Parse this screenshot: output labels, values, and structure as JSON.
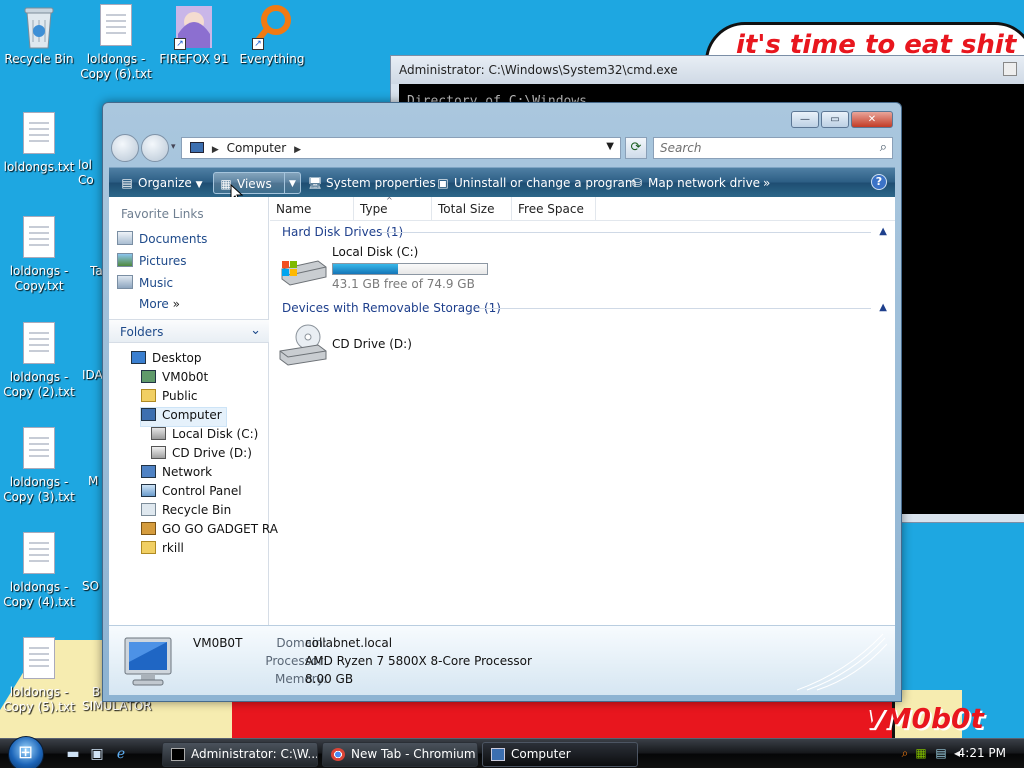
{
  "desktop": {
    "wallpaper_text": "it's time to eat shit",
    "wallpaper_signature": "VM0b0t",
    "icons": [
      {
        "label": "Recycle Bin"
      },
      {
        "label": "loldongs - Copy (6).txt"
      },
      {
        "label": "FIREFOX 91"
      },
      {
        "label": "Everything"
      },
      {
        "label": "loldongs.txt"
      },
      {
        "label": "loldongs - Copy.txt"
      },
      {
        "label": "loldongs - Copy (2).txt"
      },
      {
        "label": "loldongs - Copy (3).txt"
      },
      {
        "label": "loldongs - Copy (4).txt"
      },
      {
        "label": "loldongs - Copy (5).txt"
      }
    ],
    "partial_labels": [
      "lol",
      "Co",
      "Ta",
      "IDA",
      "M",
      "SO",
      "B",
      "SIMULATOR"
    ]
  },
  "cmd": {
    "title": "Administrator: C:\\Windows\\System32\\cmd.exe",
    "body_line": "Directory of C:\\Windows"
  },
  "explorer": {
    "address": "Computer",
    "search_placeholder": "Search",
    "toolbar": {
      "organize": "Organize",
      "views": "Views",
      "system_properties": "System properties",
      "uninstall": "Uninstall or change a program",
      "map_drive": "Map network drive",
      "more": "»"
    },
    "favorites_title": "Favorite Links",
    "favorites": [
      {
        "label": "Documents"
      },
      {
        "label": "Pictures"
      },
      {
        "label": "Music"
      },
      {
        "label": "More"
      }
    ],
    "folders_title": "Folders",
    "tree": [
      {
        "label": "Desktop"
      },
      {
        "label": "VM0b0t"
      },
      {
        "label": "Public"
      },
      {
        "label": "Computer"
      },
      {
        "label": "Local Disk (C:)"
      },
      {
        "label": "CD Drive (D:)"
      },
      {
        "label": "Network"
      },
      {
        "label": "Control Panel"
      },
      {
        "label": "Recycle Bin"
      },
      {
        "label": "GO GO GADGET RA"
      },
      {
        "label": "rkill"
      }
    ],
    "columns": [
      "Name",
      "Type",
      "Total Size",
      "Free Space"
    ],
    "groups": {
      "hard_disks": "Hard Disk Drives (1)",
      "removable": "Devices with Removable Storage (1)"
    },
    "local_disk": {
      "name": "Local Disk (C:)",
      "free_text": "43.1 GB free of 74.9 GB",
      "used_fraction": 0.425
    },
    "cd_drive": {
      "name": "CD Drive (D:)"
    },
    "details": {
      "computer_name": "VM0B0T",
      "domain_label": "Domain:",
      "domain_value": "collabnet.local",
      "processor_label": "Processor:",
      "processor_value": "AMD Ryzen 7 5800X 8-Core Processor",
      "memory_label": "Memory:",
      "memory_value": "8.00 GB"
    }
  },
  "taskbar": {
    "tasks": [
      {
        "label": "Administrator: C:\\W..."
      },
      {
        "label": "New Tab - Chromium"
      },
      {
        "label": "Computer"
      }
    ],
    "clock": "4:21 PM"
  },
  "colors": {
    "desktop": "#1ea7e1",
    "toolbar": "#2b5d84",
    "link": "#1e4a8a"
  }
}
